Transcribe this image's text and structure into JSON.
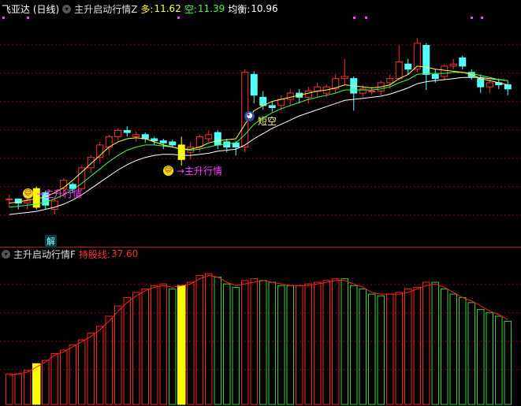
{
  "main_header": {
    "title": "飞亚达 (日线)",
    "indicator": "主升启动行情Z",
    "duo_label": "多:",
    "duo_value": "11.62",
    "kong_label": "空:",
    "kong_value": "11.39",
    "jun_label": "均衡:",
    "jun_value": "10.96"
  },
  "sub_header": {
    "indicator": "主升启动行情F",
    "hold_label": "持股线:",
    "hold_value": "37.60"
  },
  "signals": {
    "zhusheng": "→主升行情",
    "duanko": "短空",
    "jie": "解"
  },
  "icons": {
    "indicator_menu": "chevron-down-icon",
    "signal_smile": "smiley-icon",
    "bear_marker": "bear-icon"
  },
  "colors": {
    "up": "#ff3030",
    "down": "#54ffff",
    "signal": "#ffff00",
    "line_white": "#ffffff",
    "line_yellow": "#ffff40",
    "line_green": "#40ff40",
    "sub_up": "#ff2020",
    "sub_down": "#30d030",
    "annotation": "#ff40ff"
  },
  "chart_data": [
    {
      "type": "candlestick",
      "title": "飞亚达 (日线)",
      "candles": [
        [
          10.7,
          10.74,
          10.62,
          10.7
        ],
        [
          10.7,
          10.7,
          10.6,
          10.66
        ],
        [
          10.66,
          10.7,
          10.6,
          10.68
        ],
        [
          10.62,
          10.82,
          10.6,
          10.8
        ],
        [
          10.76,
          10.78,
          10.6,
          10.64
        ],
        [
          10.6,
          10.72,
          10.55,
          10.68
        ],
        [
          10.8,
          10.9,
          10.72,
          10.88
        ],
        [
          10.84,
          10.86,
          10.76,
          10.8
        ],
        [
          10.8,
          11.02,
          10.78,
          11.0
        ],
        [
          11.0,
          11.12,
          10.95,
          11.1
        ],
        [
          11.1,
          11.25,
          11.05,
          11.22
        ],
        [
          11.2,
          11.32,
          11.12,
          11.3
        ],
        [
          11.3,
          11.38,
          11.26,
          11.36
        ],
        [
          11.36,
          11.4,
          11.3,
          11.34
        ],
        [
          11.3,
          11.35,
          11.25,
          11.32
        ],
        [
          11.32,
          11.34,
          11.24,
          11.28
        ],
        [
          11.28,
          11.3,
          11.22,
          11.26
        ],
        [
          11.26,
          11.28,
          11.18,
          11.24
        ],
        [
          11.25,
          11.27,
          11.2,
          11.22
        ],
        [
          11.22,
          11.3,
          11.02,
          11.08
        ],
        [
          11.15,
          11.25,
          11.08,
          11.2
        ],
        [
          11.2,
          11.32,
          11.15,
          11.3
        ],
        [
          11.28,
          11.36,
          11.25,
          11.32
        ],
        [
          11.34,
          11.36,
          11.18,
          11.22
        ],
        [
          11.25,
          11.28,
          11.15,
          11.2
        ],
        [
          11.24,
          11.26,
          11.12,
          11.2
        ],
        [
          11.2,
          11.95,
          11.15,
          11.92
        ],
        [
          11.9,
          11.93,
          11.62,
          11.7
        ],
        [
          11.68,
          11.74,
          11.56,
          11.6
        ],
        [
          11.6,
          11.64,
          11.54,
          11.58
        ],
        [
          11.6,
          11.7,
          11.55,
          11.66
        ],
        [
          11.66,
          11.76,
          11.6,
          11.72
        ],
        [
          11.72,
          11.76,
          11.62,
          11.68
        ],
        [
          11.68,
          11.78,
          11.62,
          11.74
        ],
        [
          11.74,
          11.82,
          11.68,
          11.78
        ],
        [
          11.72,
          11.8,
          11.68,
          11.78
        ],
        [
          11.76,
          11.9,
          11.72,
          11.86
        ],
        [
          11.86,
          12.05,
          11.8,
          11.88
        ],
        [
          11.86,
          11.88,
          11.55,
          11.72
        ],
        [
          11.72,
          11.8,
          11.68,
          11.76
        ],
        [
          11.74,
          11.78,
          11.7,
          11.74
        ],
        [
          11.74,
          11.84,
          11.7,
          11.82
        ],
        [
          11.82,
          11.9,
          11.76,
          11.86
        ],
        [
          11.86,
          12.18,
          11.84,
          12.02
        ],
        [
          12.0,
          12.05,
          11.9,
          11.95
        ],
        [
          11.95,
          12.25,
          11.92,
          12.2
        ],
        [
          12.18,
          12.2,
          11.75,
          11.9
        ],
        [
          11.9,
          11.95,
          11.82,
          11.86
        ],
        [
          11.88,
          12.0,
          11.85,
          11.98
        ],
        [
          11.98,
          12.05,
          11.95,
          12.0
        ],
        [
          12.06,
          12.08,
          11.95,
          11.98
        ],
        [
          11.92,
          11.95,
          11.85,
          11.88
        ],
        [
          11.86,
          11.9,
          11.72,
          11.78
        ],
        [
          11.78,
          11.85,
          11.72,
          11.82
        ],
        [
          11.82,
          11.86,
          11.76,
          11.8
        ],
        [
          11.8,
          11.84,
          11.7,
          11.76
        ]
      ],
      "ma_short": [
        10.66,
        10.67,
        10.69,
        10.7,
        10.72,
        10.76,
        10.81,
        10.88,
        10.96,
        11.04,
        11.12,
        11.2,
        11.25,
        11.28,
        11.29,
        11.28,
        11.25,
        11.22,
        11.2,
        11.18,
        11.18,
        11.2,
        11.24,
        11.26,
        11.27,
        11.28,
        11.42,
        11.55,
        11.6,
        11.64,
        11.66,
        11.68,
        11.7,
        11.72,
        11.74,
        11.75,
        11.77,
        11.8,
        11.79,
        11.78,
        11.77,
        11.78,
        11.8,
        11.86,
        11.9,
        11.98,
        11.97,
        11.95,
        11.94,
        11.93,
        11.92,
        11.9,
        11.86,
        11.84,
        11.82,
        11.8
      ],
      "ma_mid": [
        10.62,
        10.63,
        10.64,
        10.65,
        10.67,
        10.7,
        10.74,
        10.79,
        10.85,
        10.92,
        10.99,
        11.06,
        11.12,
        11.17,
        11.2,
        11.22,
        11.22,
        11.21,
        11.2,
        11.18,
        11.17,
        11.18,
        11.2,
        11.22,
        11.23,
        11.24,
        11.32,
        11.42,
        11.48,
        11.53,
        11.57,
        11.6,
        11.63,
        11.66,
        11.68,
        11.7,
        11.72,
        11.75,
        11.75,
        11.75,
        11.75,
        11.76,
        11.78,
        11.82,
        11.85,
        11.9,
        11.91,
        11.91,
        11.91,
        11.92,
        11.92,
        11.91,
        11.89,
        11.87,
        11.85,
        11.84
      ],
      "ma_long": [
        10.55,
        10.56,
        10.57,
        10.58,
        10.6,
        10.62,
        10.65,
        10.69,
        10.74,
        10.8,
        10.86,
        10.92,
        10.98,
        11.03,
        11.07,
        11.1,
        11.12,
        11.13,
        11.13,
        11.12,
        11.12,
        11.13,
        11.14,
        11.16,
        11.17,
        11.18,
        11.22,
        11.28,
        11.33,
        11.38,
        11.42,
        11.46,
        11.5,
        11.53,
        11.56,
        11.59,
        11.62,
        11.65,
        11.66,
        11.67,
        11.68,
        11.69,
        11.71,
        11.74,
        11.77,
        11.81,
        11.83,
        11.84,
        11.85,
        11.86,
        11.87,
        11.87,
        11.87,
        11.86,
        11.85,
        11.84
      ],
      "signal_bars": [
        3,
        19
      ],
      "ylim": [
        10.3,
        12.45
      ],
      "legend": [
        "多: 11.62",
        "空: 11.39",
        "均衡: 10.96"
      ]
    },
    {
      "type": "bar",
      "title": "主升启动行情F",
      "values": [
        18,
        18,
        20,
        24,
        26,
        30,
        32,
        35,
        38,
        42,
        46,
        52,
        58,
        63,
        66,
        68,
        70,
        71,
        68,
        70,
        72,
        76,
        77,
        75,
        71,
        69,
        73,
        74,
        73,
        72,
        70,
        70,
        70,
        71,
        72,
        73,
        74,
        74,
        70,
        68,
        65,
        64,
        65,
        66,
        68,
        69,
        72,
        72,
        68,
        65,
        63,
        60,
        56,
        54,
        52,
        49
      ],
      "up": [
        true,
        true,
        true,
        true,
        true,
        true,
        true,
        true,
        true,
        true,
        true,
        true,
        true,
        true,
        true,
        true,
        true,
        true,
        false,
        true,
        true,
        true,
        true,
        false,
        false,
        false,
        true,
        true,
        false,
        false,
        false,
        false,
        true,
        true,
        true,
        true,
        true,
        false,
        false,
        false,
        false,
        false,
        true,
        true,
        true,
        true,
        true,
        false,
        false,
        false,
        false,
        false,
        false,
        false,
        false,
        false
      ],
      "signal_bars": [
        3,
        19
      ],
      "line_values": [
        17,
        18,
        19,
        22,
        25,
        29,
        31,
        34,
        37,
        40,
        44,
        49,
        55,
        60,
        64,
        67,
        69,
        70,
        69,
        70,
        71,
        74,
        76,
        75,
        72,
        70,
        71,
        72,
        73,
        72,
        71,
        70,
        70,
        70,
        71,
        72,
        73,
        73,
        71,
        69,
        66,
        65,
        65,
        65,
        66,
        68,
        70,
        71,
        69,
        66,
        63,
        61,
        58,
        55,
        53,
        50
      ],
      "ylim": [
        0,
        85
      ]
    }
  ]
}
